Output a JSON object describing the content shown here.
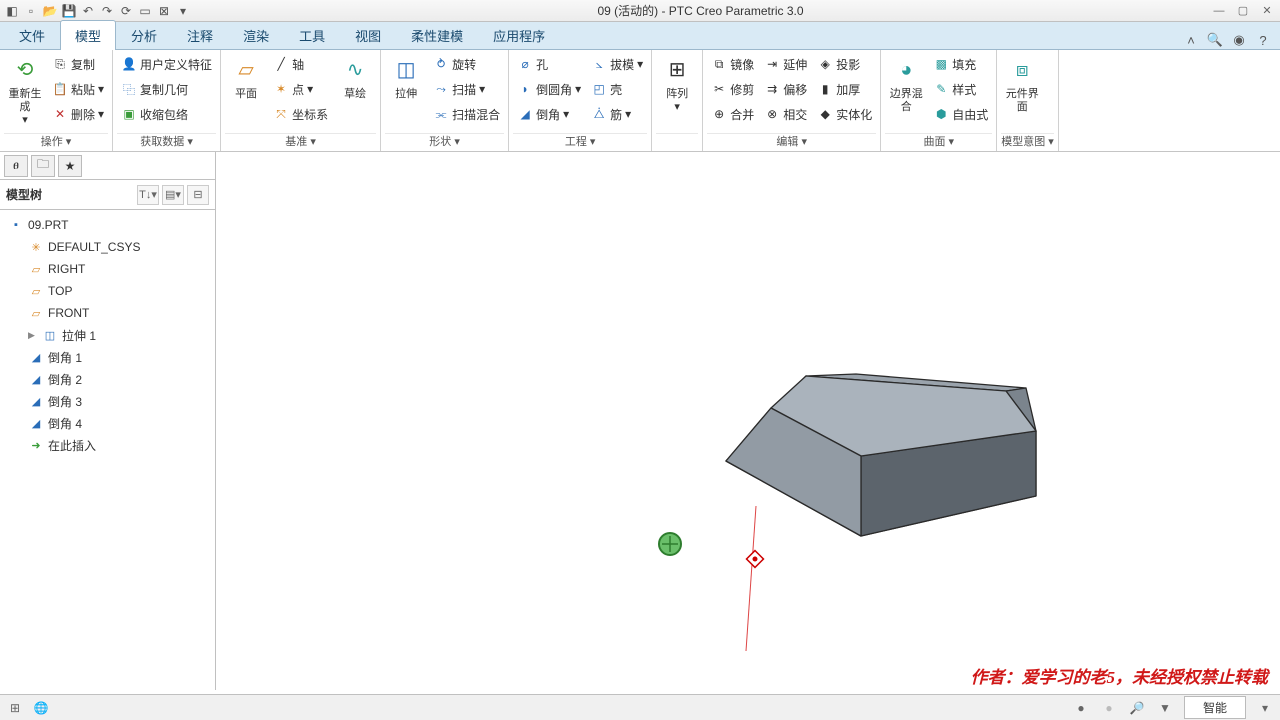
{
  "title": "09 (活动的) - PTC Creo Parametric 3.0",
  "tabs": {
    "file": "文件",
    "model": "模型",
    "analysis": "分析",
    "annotate": "注释",
    "render": "渲染",
    "tools": "工具",
    "view": "视图",
    "flex": "柔性建模",
    "apps": "应用程序"
  },
  "ribbon": {
    "ops": {
      "label": "操作",
      "regen": "重新生成",
      "copy": "复制",
      "paste": "粘贴",
      "delete": "删除"
    },
    "data": {
      "label": "获取数据",
      "udf": "用户定义特征",
      "copygeom": "复制几何",
      "shrink": "收缩包络"
    },
    "datum": {
      "label": "基准",
      "plane": "平面",
      "sketch": "草绘",
      "axis": "轴",
      "point": "点",
      "csys": "坐标系"
    },
    "shape": {
      "label": "形状",
      "extrude": "拉伸",
      "revolve": "旋转",
      "sweep": "扫描",
      "blend": "扫描混合"
    },
    "eng": {
      "label": "工程",
      "hole": "孔",
      "round": "倒圆角",
      "chamfer": "倒角",
      "draft": "拔模",
      "shell": "壳",
      "rib": "筋"
    },
    "pattern": {
      "label": "",
      "btn": "阵列"
    },
    "edit": {
      "label": "编辑",
      "mirror": "镜像",
      "trim": "修剪",
      "merge": "合并",
      "extend": "延伸",
      "offset": "偏移",
      "intersect": "相交",
      "project": "投影",
      "thicken": "加厚",
      "solidify": "实体化"
    },
    "surf": {
      "label": "曲面",
      "bnd": "边界混合",
      "fill": "填充",
      "style": "样式",
      "free": "自由式"
    },
    "intent": {
      "label": "模型意图",
      "btn": "元件界面"
    }
  },
  "tree": {
    "title": "模型树",
    "root": "09.PRT",
    "items": [
      "DEFAULT_CSYS",
      "RIGHT",
      "TOP",
      "FRONT",
      "拉伸 1",
      "倒角 1",
      "倒角 2",
      "倒角 3",
      "倒角 4",
      "在此插入"
    ]
  },
  "status": {
    "mode": "智能"
  },
  "watermark": "作者：爱学习的老5，未经授权禁止转载"
}
